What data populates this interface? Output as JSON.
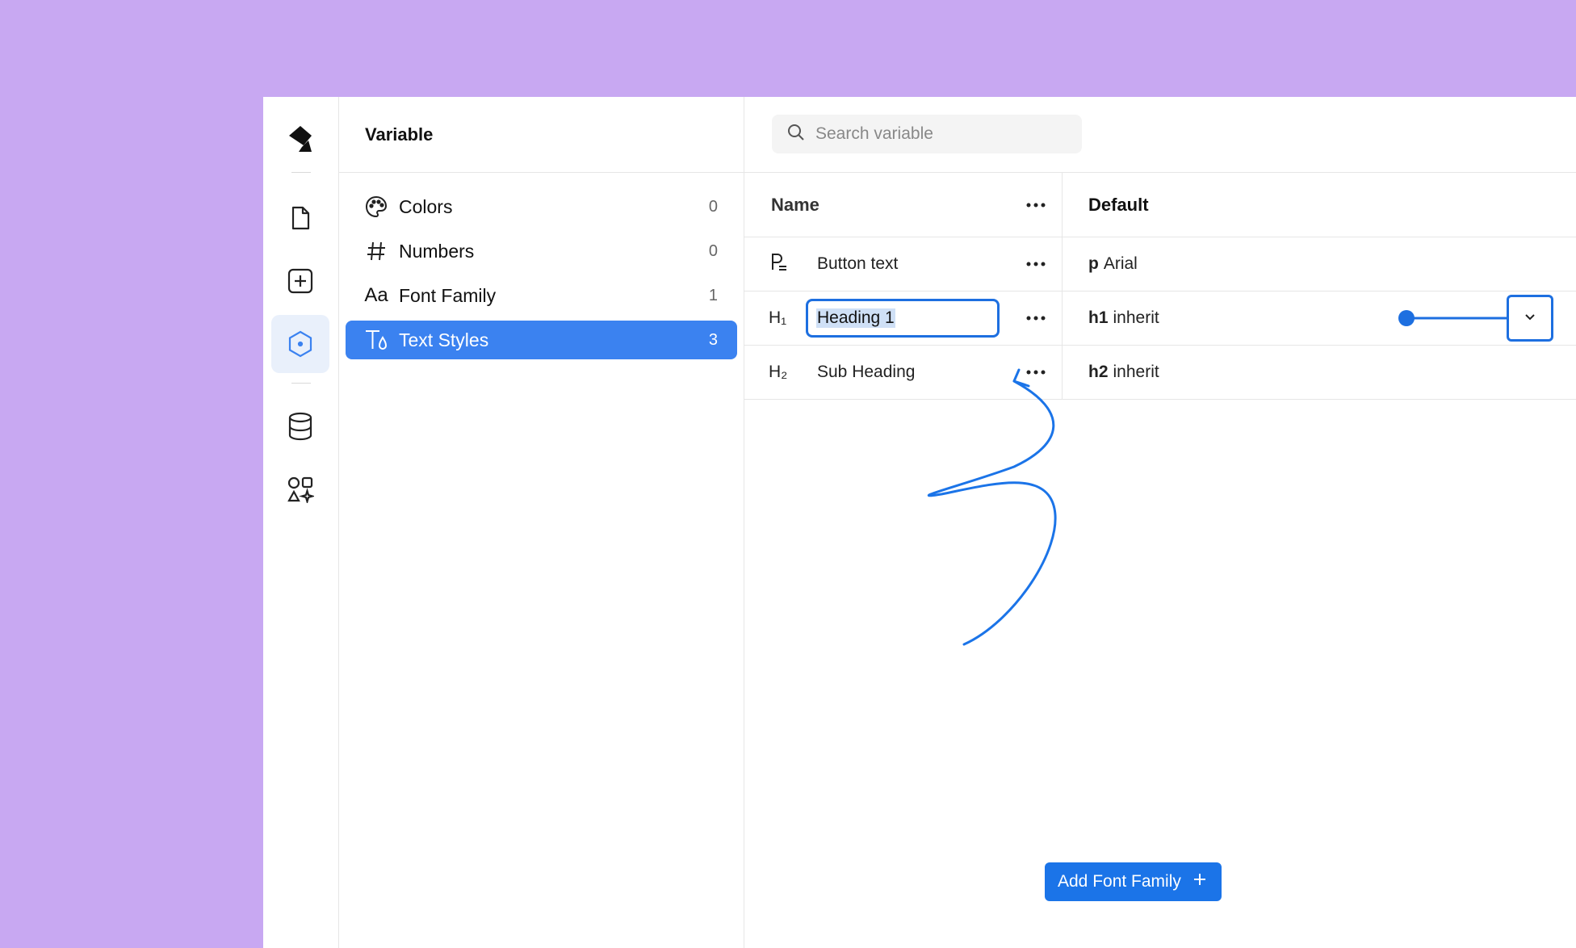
{
  "sidebar": {
    "items": [
      {
        "icon": "logo-icon"
      },
      {
        "icon": "page-icon"
      },
      {
        "icon": "add-box-icon"
      },
      {
        "icon": "variable-hexagon-icon",
        "active": true
      },
      {
        "icon": "database-icon"
      },
      {
        "icon": "components-icon"
      }
    ]
  },
  "variable_panel": {
    "title": "Variable",
    "categories": [
      {
        "label": "Colors",
        "count": "0",
        "icon": "palette-icon"
      },
      {
        "label": "Numbers",
        "count": "0",
        "icon": "hash-icon"
      },
      {
        "label": "Font Family",
        "count": "1",
        "icon": "font-aa-icon"
      },
      {
        "label": "Text Styles",
        "count": "3",
        "icon": "text-style-icon",
        "active": true
      }
    ]
  },
  "search": {
    "placeholder": "Search variable"
  },
  "table": {
    "headers": {
      "name": "Name",
      "default": "Default"
    },
    "rows": [
      {
        "icon_text": "P",
        "name": "Button text",
        "tag": "p",
        "value": "Arial"
      },
      {
        "icon_text": "H₁",
        "name": "Heading 1",
        "tag": "h1",
        "value": "inherit",
        "editing": true
      },
      {
        "icon_text": "H₂",
        "name": "Sub Heading",
        "tag": "h2",
        "value": "inherit"
      }
    ]
  },
  "add_button": {
    "label": "Add Font Family"
  },
  "colors": {
    "accent": "#3b82f0",
    "highlight": "#1d6fe0",
    "background": "#c8a8f2"
  }
}
